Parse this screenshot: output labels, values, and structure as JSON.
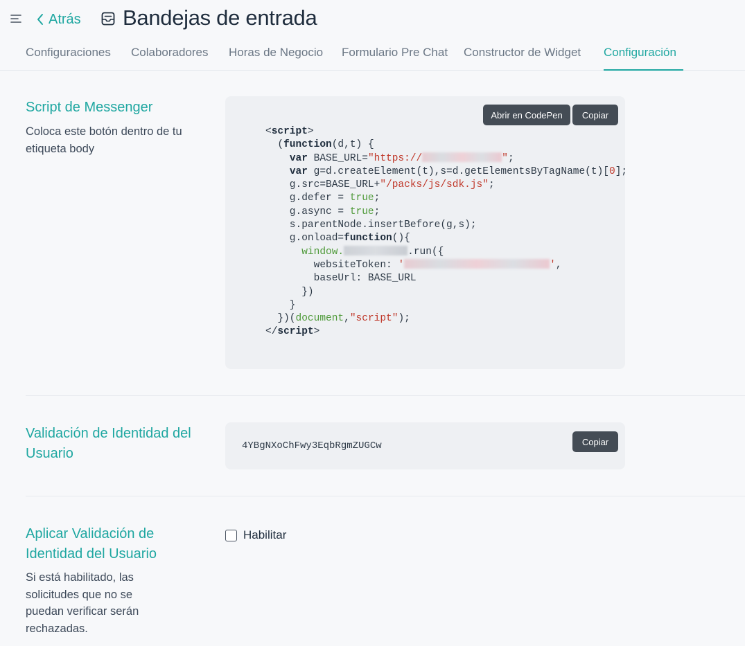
{
  "header": {
    "back_label": "Atrás",
    "title": "Bandejas de entrada"
  },
  "tabs": [
    {
      "label": "Configuraciones"
    },
    {
      "label": "Colaboradores"
    },
    {
      "label": "Horas de Negocio"
    },
    {
      "label": "Formulario Pre Chat"
    },
    {
      "label": "Constructor de Widget"
    },
    {
      "label": "Configuración",
      "active": true
    }
  ],
  "messenger_script": {
    "title": "Script de Messenger",
    "description": "Coloca este botón dentro de tu etiqueta body",
    "codepen_label": "Abrir en CodePen",
    "copy_label": "Copiar",
    "code": {
      "base_url_prefix": "https://",
      "sdk_path": "/packs/js/sdk.js",
      "zero": "0",
      "true_literal": "true",
      "window_ref": "window.",
      "run_suffix": ".run({",
      "script_name": "script",
      "document_name": "document"
    }
  },
  "identity_validation": {
    "title": "Validación de Identidad del Usuario",
    "token": "4YBgNXoChFwy3EqbRgmZUGCw",
    "copy_label": "Copiar"
  },
  "enforce_validation": {
    "title": "Aplicar Validación de Identidad del Usuario",
    "description": "Si está habilitado, las solicitudes que no se puedan verificar serán rechazadas.",
    "checkbox_label": "Habilitar",
    "checked": false
  },
  "colors": {
    "accent": "#1fa7a1",
    "text": "#1f2d3d",
    "muted": "#6b7785",
    "button": "#444c55",
    "card": "#eef0f3",
    "background": "#f7f8fa"
  },
  "icons": [
    "menu-icon",
    "chevron-left-icon",
    "inbox-icon"
  ]
}
